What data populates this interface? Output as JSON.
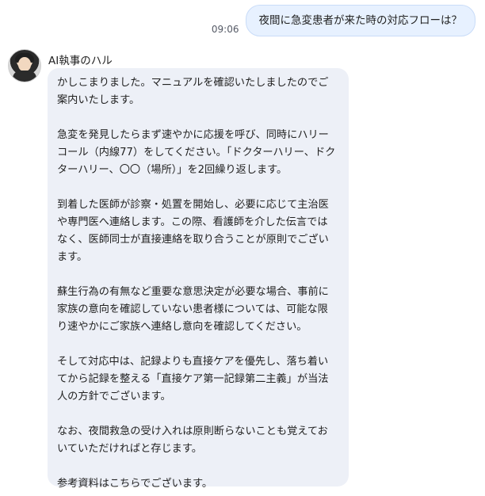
{
  "outgoing": {
    "time": "09:06",
    "message": "夜間に急変患者が来た時の対応フローは？"
  },
  "incoming": {
    "sender": "AI執事のハル",
    "avatar_icon": "butler-avatar-icon",
    "paragraphs": [
      "かしこまりました。マニュアルを確認いたしましたのでご案内いたします。",
      "急変を発見したらまず速やかに応援を呼び、同時にハリーコール（内線77）をしてください。「ドクターハリー、ドクターハリー、〇〇（場所）」を2回繰り返します。",
      "到着した医師が診察・処置を開始し、必要に応じて主治医や専門医へ連絡します。この際、看護師を介した伝言ではなく、医師同士が直接連絡を取り合うことが原則でございます。",
      "蘇生行為の有無など重要な意思決定が必要な場合、事前に家族の意向を確認していない患者様については、可能な限り速やかにご家族へ連絡し意向を確認してください。",
      "そして対応中は、記録よりも直接ケアを優先し、落ち着いてから記録を整える「直接ケア第一記録第二主義」が当法人の方針でございます。",
      "なお、夜間救急の受け入れは原則断らないことも覚えておいていただければと存じます。",
      "参考資料はこちらでございます。"
    ]
  },
  "colors": {
    "outgoing_bubble": "#e7f1ff",
    "incoming_bubble": "#edf0f7",
    "text": "#222222"
  }
}
